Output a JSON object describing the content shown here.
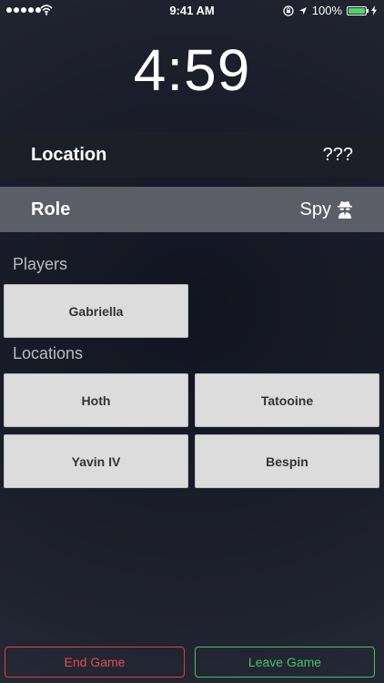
{
  "status_bar": {
    "time": "9:41 AM",
    "battery_percent": "100%",
    "battery_level": 1.0,
    "icons": [
      "signal-dots-icon",
      "wifi-icon",
      "rotation-lock-icon",
      "location-arrow-icon",
      "battery-icon",
      "charging-bolt-icon"
    ]
  },
  "timer": {
    "value": "4:59"
  },
  "location_row": {
    "label": "Location",
    "value": "???"
  },
  "role_row": {
    "label": "Role",
    "value": "Spy",
    "icon": "spy-icon"
  },
  "players": {
    "header": "Players",
    "items": [
      "Gabriella"
    ]
  },
  "locations": {
    "header": "Locations",
    "items": [
      "Hoth",
      "Tatooine",
      "Yavin IV",
      "Bespin"
    ]
  },
  "actions": {
    "end_game": "End Game",
    "leave_game": "Leave Game"
  },
  "colors": {
    "end_game": "#e04d4d",
    "leave_game": "#43c463",
    "battery": "#4cd964"
  }
}
